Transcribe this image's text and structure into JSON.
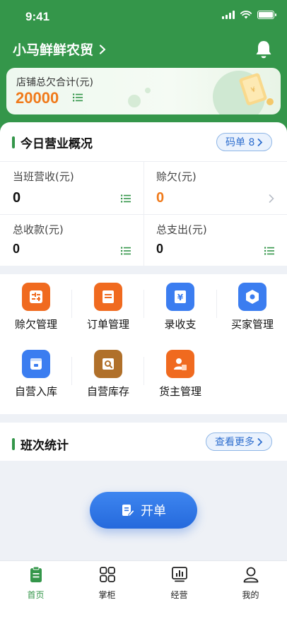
{
  "status_bar": {
    "time": "9:41"
  },
  "header": {
    "shop_name": "小马鲜鲜农贸",
    "chevron": ">"
  },
  "debt_card": {
    "title": "店铺总欠合计(元)",
    "value": "20000"
  },
  "overview": {
    "title": "今日营业概况",
    "qr_button": "码单 8",
    "stats": [
      {
        "label": "当班营收(元)",
        "value": "0",
        "value_color": "#111111",
        "action": "list-icon"
      },
      {
        "label": "赊欠(元)",
        "value": "0",
        "value_color": "#f07a1a",
        "action": "chevron-right-icon"
      },
      {
        "label": "总收款(元)",
        "value": "0",
        "value_color": "#111111",
        "action": "list-icon"
      },
      {
        "label": "总支出(元)",
        "value": "0",
        "value_color": "#111111",
        "action": "list-icon"
      }
    ]
  },
  "menu": {
    "items": [
      {
        "label": "赊欠管理",
        "icon": "credit-management-icon",
        "color": "#f06a1f"
      },
      {
        "label": "订单管理",
        "icon": "order-management-icon",
        "color": "#f06a1f"
      },
      {
        "label": "录收支",
        "icon": "income-expense-icon",
        "color": "#3b7df0"
      },
      {
        "label": "买家管理",
        "icon": "buyer-management-icon",
        "color": "#3b7df0"
      },
      {
        "label": "自营入库",
        "icon": "warehouse-in-icon",
        "color": "#3b7df0"
      },
      {
        "label": "自营库存",
        "icon": "inventory-icon",
        "color": "#b0702a"
      },
      {
        "label": "货主管理",
        "icon": "owner-management-icon",
        "color": "#f06a1f"
      }
    ]
  },
  "shift": {
    "title": "班次统计",
    "more_button": "查看更多"
  },
  "open_order": {
    "label": "开单"
  },
  "tabbar": {
    "active_color": "#34964a",
    "tabs": [
      {
        "label": "首页",
        "icon": "home-icon",
        "active": true
      },
      {
        "label": "掌柜",
        "icon": "grid-icon",
        "active": false
      },
      {
        "label": "经营",
        "icon": "chart-icon",
        "active": false
      },
      {
        "label": "我的",
        "icon": "user-icon",
        "active": false
      }
    ]
  },
  "colors": {
    "brand_green": "#34964a",
    "accent_orange": "#f07a1a",
    "link_blue": "#2f6fcf"
  }
}
